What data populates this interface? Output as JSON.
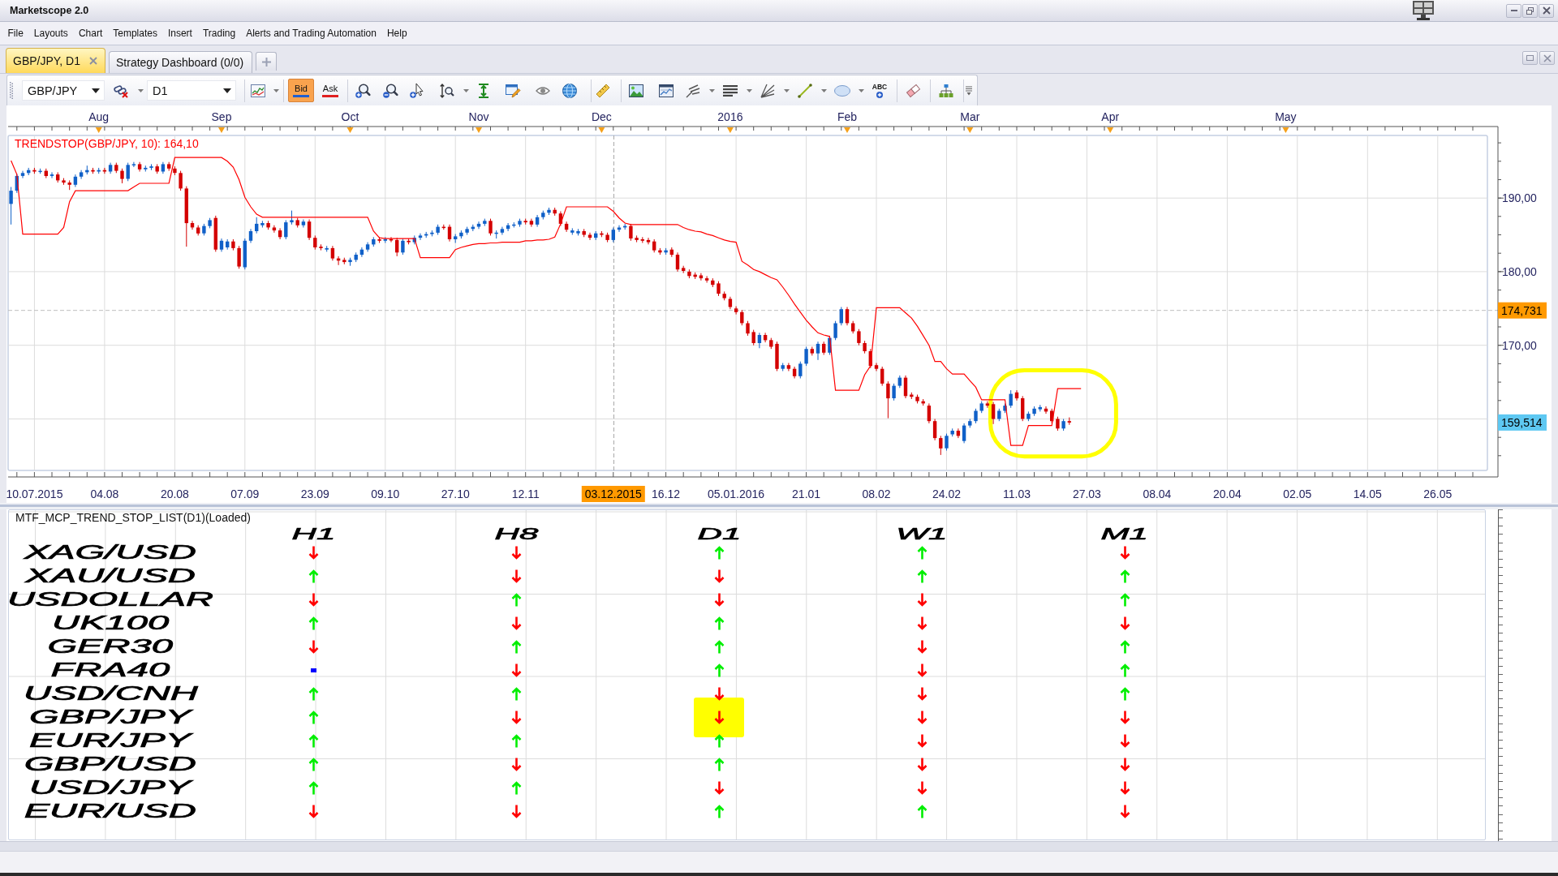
{
  "window": {
    "title": "Marketscope 2.0"
  },
  "menu": [
    "File",
    "Layouts",
    "Chart",
    "Templates",
    "Insert",
    "Trading",
    "Alerts and Trading Automation",
    "Help"
  ],
  "tabs": [
    {
      "label": "GBP/JPY, D1",
      "selected": true,
      "closable": true
    },
    {
      "label": "Strategy Dashboard (0/0)",
      "selected": false,
      "closable": false
    }
  ],
  "toolbar": {
    "symbol": "GBP/JPY",
    "timeframe": "D1",
    "price_modes": [
      {
        "label": "Bid",
        "selected": true,
        "color": "#2060d0"
      },
      {
        "label": "Ask",
        "selected": false,
        "color": "#e02020"
      }
    ],
    "text_tool": "ABC"
  },
  "chart": {
    "month_axis": [
      "Aug",
      "Sep",
      "Oct",
      "Nov",
      "Dec",
      "2016",
      "Feb",
      "Mar",
      "Apr",
      "May"
    ],
    "highlight_ring": true,
    "chart_data": [
      {
        "type": "candlestick",
        "grid": true,
        "ylim": [
          153.0,
          198.5
        ],
        "categories": [
          null,
          null,
          null,
          null,
          "10.07.2015",
          null,
          null,
          null,
          null,
          null,
          null,
          null,
          null,
          null,
          null,
          null,
          "04.08",
          null,
          null,
          null,
          null,
          null,
          null,
          null,
          null,
          null,
          null,
          null,
          "20.08",
          null,
          null,
          null,
          null,
          null,
          null,
          null,
          null,
          null,
          null,
          null,
          "07.09",
          null,
          null,
          null,
          null,
          null,
          null,
          null,
          null,
          null,
          null,
          null,
          "23.09",
          null,
          null,
          null,
          null,
          null,
          null,
          null,
          null,
          null,
          null,
          null,
          "09.10",
          null,
          null,
          null,
          null,
          null,
          null,
          null,
          null,
          null,
          null,
          null,
          "27.10",
          null,
          null,
          null,
          null,
          null,
          null,
          null,
          null,
          null,
          null,
          null,
          "12.11",
          null,
          null,
          null,
          null,
          null,
          null,
          null,
          null,
          null,
          null,
          null,
          null,
          null,
          null,
          "03.12.2015",
          null,
          null,
          null,
          null,
          null,
          null,
          null,
          null,
          "16.12",
          null,
          null,
          null,
          null,
          null,
          null,
          null,
          null,
          null,
          null,
          null,
          "05.01.2016",
          null,
          null,
          null,
          null,
          null,
          null,
          null,
          null,
          null,
          null,
          null,
          "21.01",
          null,
          null,
          null,
          null,
          null,
          null,
          null,
          null,
          null,
          null,
          null,
          "08.02",
          null,
          null,
          null,
          null,
          null,
          null,
          null,
          null,
          null,
          null,
          null,
          "24.02",
          null,
          null,
          null,
          null,
          null,
          null,
          null,
          null,
          null,
          null,
          null,
          "11.03",
          null,
          null,
          null,
          null,
          null,
          null,
          null,
          null,
          null,
          null,
          null,
          "27.03",
          null,
          null,
          null,
          null,
          null,
          null,
          null,
          null,
          null,
          null,
          null,
          "08.04",
          null,
          null,
          null,
          null,
          null,
          null,
          null,
          null,
          null,
          null,
          null,
          "20.04",
          null,
          null,
          null,
          null,
          null,
          null,
          null,
          null,
          null,
          null,
          null,
          "02.05",
          null,
          null,
          null,
          null,
          null,
          null,
          null,
          null,
          null,
          null,
          null,
          "14.05",
          null,
          null,
          null,
          null,
          null,
          null,
          null,
          null,
          null,
          null,
          null,
          "26.05",
          null,
          null,
          null,
          null,
          null,
          null,
          null,
          null
        ],
        "yticks": [
          {
            "value": 170,
            "label": "170,00"
          },
          {
            "value": 180,
            "label": "180,00"
          },
          {
            "value": 190,
            "label": "190,00"
          }
        ],
        "ohlc": [
          [
            189.2,
            191.5,
            186.4,
            191.0
          ],
          [
            191.0,
            193.3,
            190.7,
            193.0
          ],
          [
            193.0,
            193.7,
            192.7,
            193.4
          ],
          [
            193.4,
            194.1,
            193.1,
            193.8
          ],
          [
            193.8,
            194.1,
            193.3,
            193.6
          ],
          [
            193.6,
            194.0,
            193.3,
            193.7
          ],
          [
            193.7,
            194.0,
            192.7,
            193.0
          ],
          [
            193.0,
            193.5,
            192.7,
            193.2
          ],
          [
            193.2,
            193.5,
            192.1,
            192.4
          ],
          [
            192.4,
            192.7,
            191.8,
            192.1
          ],
          [
            192.1,
            192.4,
            191.1,
            191.8
          ],
          [
            191.8,
            193.2,
            191.5,
            192.9
          ],
          [
            192.9,
            193.8,
            192.6,
            193.5
          ],
          [
            193.5,
            194.4,
            193.2,
            193.8
          ],
          [
            193.8,
            194.1,
            193.3,
            193.6
          ],
          [
            193.6,
            194.1,
            193.3,
            193.8
          ],
          [
            193.8,
            194.1,
            193.3,
            193.6
          ],
          [
            193.6,
            194.8,
            193.3,
            194.5
          ],
          [
            194.5,
            194.8,
            193.4,
            193.7
          ],
          [
            193.7,
            194.0,
            192.0,
            192.6
          ],
          [
            192.6,
            194.8,
            192.3,
            194.5
          ],
          [
            194.5,
            194.9,
            194.2,
            194.6
          ],
          [
            194.6,
            194.9,
            193.6,
            193.9
          ],
          [
            193.9,
            194.4,
            193.6,
            194.1
          ],
          [
            194.1,
            194.6,
            193.8,
            194.3
          ],
          [
            194.3,
            194.6,
            193.3,
            193.6
          ],
          [
            193.6,
            194.9,
            193.3,
            194.6
          ],
          [
            194.6,
            194.9,
            193.7,
            194.0
          ],
          [
            194.0,
            194.3,
            193.1,
            193.4
          ],
          [
            193.4,
            193.7,
            191.0,
            191.3
          ],
          [
            191.3,
            191.6,
            183.4,
            186.6
          ],
          [
            186.6,
            186.9,
            185.7,
            186.0
          ],
          [
            186.0,
            186.3,
            184.9,
            185.2
          ],
          [
            185.2,
            186.5,
            184.9,
            186.2
          ],
          [
            186.2,
            187.3,
            185.9,
            187.0
          ],
          [
            187.3,
            187.6,
            182.7,
            183.0
          ],
          [
            183.0,
            184.5,
            182.7,
            184.2
          ],
          [
            183.3,
            184.4,
            183.0,
            184.1
          ],
          [
            184.1,
            184.4,
            182.9,
            183.2
          ],
          [
            183.2,
            183.5,
            180.4,
            180.7
          ],
          [
            180.6,
            184.5,
            180.3,
            184.2
          ],
          [
            184.2,
            185.8,
            183.9,
            185.5
          ],
          [
            185.5,
            187.4,
            185.2,
            186.5
          ],
          [
            186.3,
            186.9,
            186.0,
            186.6
          ],
          [
            186.6,
            186.9,
            185.7,
            186.0
          ],
          [
            186.0,
            186.3,
            185.3,
            185.6
          ],
          [
            185.6,
            185.9,
            184.4,
            184.7
          ],
          [
            184.7,
            187.0,
            184.4,
            186.7
          ],
          [
            186.7,
            188.3,
            186.4,
            187.0
          ],
          [
            187.0,
            187.3,
            186.0,
            186.3
          ],
          [
            186.3,
            187.1,
            186.0,
            186.8
          ],
          [
            186.8,
            187.1,
            184.3,
            184.6
          ],
          [
            184.6,
            184.9,
            183.0,
            183.3
          ],
          [
            183.4,
            183.7,
            182.9,
            183.2
          ],
          [
            183.0,
            183.5,
            182.7,
            183.2
          ],
          [
            183.2,
            183.5,
            181.5,
            181.8
          ],
          [
            181.8,
            182.1,
            180.9,
            181.5
          ],
          [
            181.6,
            181.9,
            181.0,
            181.3
          ],
          [
            181.3,
            181.9,
            180.8,
            181.6
          ],
          [
            181.6,
            182.6,
            181.3,
            182.3
          ],
          [
            182.3,
            183.3,
            182.0,
            183.0
          ],
          [
            183.0,
            184.0,
            182.7,
            183.7
          ],
          [
            183.7,
            184.7,
            183.4,
            184.4
          ],
          [
            184.4,
            184.7,
            183.9,
            184.2
          ],
          [
            184.2,
            184.7,
            183.9,
            184.4
          ],
          [
            184.4,
            184.7,
            184.0,
            184.3
          ],
          [
            184.3,
            184.6,
            182.1,
            182.6
          ],
          [
            182.6,
            184.5,
            182.3,
            184.2
          ],
          [
            184.2,
            184.5,
            183.7,
            184.0
          ],
          [
            184.0,
            184.9,
            183.7,
            184.6
          ],
          [
            184.6,
            185.2,
            184.3,
            184.9
          ],
          [
            184.9,
            185.4,
            184.6,
            185.1
          ],
          [
            185.1,
            185.6,
            184.8,
            185.3
          ],
          [
            185.3,
            186.4,
            185.0,
            186.1
          ],
          [
            186.1,
            186.4,
            185.7,
            186.0
          ],
          [
            186.1,
            186.4,
            184.1,
            184.4
          ],
          [
            184.4,
            185.1,
            183.9,
            184.8
          ],
          [
            184.8,
            185.6,
            184.5,
            185.3
          ],
          [
            185.3,
            186.1,
            185.0,
            185.8
          ],
          [
            185.8,
            186.4,
            185.5,
            186.1
          ],
          [
            186.1,
            186.8,
            185.8,
            186.5
          ],
          [
            186.5,
            187.2,
            186.2,
            186.9
          ],
          [
            186.9,
            187.2,
            184.9,
            185.2
          ],
          [
            185.2,
            185.6,
            184.5,
            185.3
          ],
          [
            185.3,
            186.1,
            185.0,
            185.8
          ],
          [
            185.8,
            186.6,
            185.5,
            186.3
          ],
          [
            186.3,
            186.7,
            186.0,
            186.4
          ],
          [
            186.4,
            187.2,
            186.1,
            186.9
          ],
          [
            186.9,
            187.2,
            186.4,
            186.7
          ],
          [
            186.9,
            187.2,
            186.1,
            186.4
          ],
          [
            186.4,
            187.7,
            186.1,
            187.4
          ],
          [
            187.4,
            188.3,
            187.1,
            188.0
          ],
          [
            188.0,
            188.7,
            187.7,
            188.4
          ],
          [
            188.4,
            188.7,
            187.6,
            187.9
          ],
          [
            187.9,
            188.2,
            186.2,
            186.5
          ],
          [
            186.5,
            186.8,
            185.4,
            185.7
          ],
          [
            185.3,
            185.9,
            185.0,
            185.6
          ],
          [
            185.2,
            185.8,
            184.9,
            185.5
          ],
          [
            185.5,
            185.8,
            184.7,
            185.0
          ],
          [
            185.0,
            185.3,
            184.3,
            184.6
          ],
          [
            184.6,
            185.5,
            184.3,
            185.2
          ],
          [
            185.2,
            185.5,
            184.7,
            185.0
          ],
          [
            185.0,
            185.3,
            184.0,
            184.3
          ],
          [
            184.3,
            186.0,
            184.0,
            185.7
          ],
          [
            185.7,
            186.3,
            185.4,
            186.0
          ],
          [
            186.0,
            186.5,
            185.7,
            186.2
          ],
          [
            186.2,
            186.5,
            184.2,
            184.5
          ],
          [
            184.6,
            184.9,
            184.0,
            184.3
          ],
          [
            184.4,
            184.7,
            183.9,
            184.2
          ],
          [
            184.3,
            184.6,
            183.7,
            184.0
          ],
          [
            184.1,
            184.4,
            182.6,
            182.9
          ],
          [
            182.9,
            183.2,
            182.3,
            182.6
          ],
          [
            182.6,
            183.2,
            182.3,
            182.9
          ],
          [
            183.0,
            183.3,
            182.0,
            182.3
          ],
          [
            182.3,
            182.6,
            180.0,
            180.3
          ],
          [
            180.5,
            180.8,
            179.8,
            180.1
          ],
          [
            180.0,
            180.3,
            179.1,
            179.4
          ],
          [
            179.6,
            179.9,
            179.0,
            179.3
          ],
          [
            179.5,
            179.8,
            178.8,
            179.1
          ],
          [
            179.1,
            179.4,
            178.5,
            178.8
          ],
          [
            178.8,
            179.1,
            177.9,
            178.2
          ],
          [
            178.4,
            178.7,
            176.7,
            177.0
          ],
          [
            177.0,
            177.3,
            176.1,
            176.4
          ],
          [
            176.3,
            176.6,
            174.9,
            175.2
          ],
          [
            175.0,
            175.3,
            174.2,
            174.5
          ],
          [
            174.5,
            174.8,
            172.7,
            173.0
          ],
          [
            173.0,
            173.3,
            171.3,
            171.6
          ],
          [
            171.8,
            172.1,
            170.0,
            170.3
          ],
          [
            170.3,
            171.7,
            169.6,
            171.4
          ],
          [
            171.4,
            171.7,
            170.4,
            170.7
          ],
          [
            170.7,
            171.0,
            169.5,
            169.8
          ],
          [
            170.2,
            170.5,
            166.5,
            166.8
          ],
          [
            166.8,
            167.6,
            166.5,
            167.3
          ],
          [
            167.3,
            167.6,
            166.5,
            166.8
          ],
          [
            166.8,
            167.1,
            165.5,
            165.8
          ],
          [
            165.8,
            167.8,
            165.5,
            167.5
          ],
          [
            167.5,
            169.8,
            167.2,
            169.5
          ],
          [
            169.5,
            169.8,
            168.6,
            168.9
          ],
          [
            168.9,
            170.5,
            168.0,
            170.2
          ],
          [
            170.2,
            170.5,
            168.7,
            169.0
          ],
          [
            169.0,
            171.3,
            168.7,
            171.0
          ],
          [
            171.0,
            173.3,
            170.7,
            173.0
          ],
          [
            173.0,
            175.2,
            172.7,
            174.9
          ],
          [
            174.9,
            175.2,
            172.7,
            173.0
          ],
          [
            173.0,
            173.3,
            171.6,
            171.9
          ],
          [
            171.9,
            172.2,
            170.0,
            170.3
          ],
          [
            170.3,
            170.6,
            168.9,
            169.2
          ],
          [
            169.2,
            169.5,
            166.9,
            167.2
          ],
          [
            167.3,
            167.6,
            166.5,
            166.8
          ],
          [
            166.8,
            167.1,
            164.5,
            164.8
          ],
          [
            164.8,
            165.1,
            160.1,
            162.8
          ],
          [
            162.8,
            164.8,
            162.5,
            164.5
          ],
          [
            164.5,
            165.9,
            164.2,
            165.6
          ],
          [
            165.6,
            165.9,
            162.8,
            163.1
          ],
          [
            163.3,
            163.6,
            162.7,
            163.0
          ],
          [
            163.0,
            163.3,
            162.1,
            162.4
          ],
          [
            162.4,
            162.7,
            161.8,
            162.1
          ],
          [
            161.8,
            162.1,
            159.4,
            159.7
          ],
          [
            159.7,
            160.0,
            157.1,
            157.4
          ],
          [
            157.4,
            157.7,
            155.1,
            156.0
          ],
          [
            156.0,
            158.0,
            155.7,
            157.7
          ],
          [
            157.9,
            158.7,
            157.6,
            158.4
          ],
          [
            158.4,
            158.7,
            157.4,
            157.7
          ],
          [
            157.0,
            159.4,
            156.7,
            159.1
          ],
          [
            159.1,
            160.0,
            158.8,
            159.7
          ],
          [
            159.7,
            161.4,
            159.4,
            161.1
          ],
          [
            161.1,
            162.4,
            160.8,
            162.1
          ],
          [
            162.1,
            162.4,
            161.5,
            161.8
          ],
          [
            162.0,
            162.3,
            159.3,
            160.0
          ],
          [
            160.0,
            161.4,
            159.7,
            161.1
          ],
          [
            161.1,
            162.1,
            160.8,
            161.8
          ],
          [
            161.8,
            163.9,
            161.5,
            163.4
          ],
          [
            163.6,
            163.9,
            162.5,
            162.8
          ],
          [
            162.8,
            163.1,
            159.7,
            160.0
          ],
          [
            160.0,
            161.0,
            159.7,
            160.7
          ],
          [
            160.7,
            161.7,
            160.4,
            161.4
          ],
          [
            161.3,
            161.9,
            161.0,
            161.6
          ],
          [
            161.4,
            161.7,
            160.7,
            161.0
          ],
          [
            161.1,
            161.4,
            159.4,
            159.7
          ],
          [
            160.0,
            160.3,
            158.4,
            158.7
          ],
          [
            158.7,
            160.0,
            158.4,
            159.7
          ],
          [
            159.7,
            160.2,
            159.2,
            159.51
          ],
          null,
          null,
          null,
          null,
          null,
          null,
          null,
          null,
          null,
          null,
          null,
          null,
          null,
          null,
          null,
          null,
          null,
          null,
          null,
          null,
          null,
          null,
          null,
          null,
          null,
          null,
          null,
          null,
          null,
          null,
          null,
          null,
          null,
          null,
          null,
          null,
          null,
          null,
          null,
          null,
          null,
          null,
          null,
          null,
          null,
          null,
          null,
          null,
          null,
          null,
          null,
          null,
          null,
          null,
          null,
          null,
          null,
          null,
          null,
          null,
          null,
          null,
          null,
          null,
          null,
          null,
          null,
          null,
          null,
          null,
          null
        ],
        "series": [
          {
            "name": "TRENDSTOP(GBP/JPY, 10): 164,10",
            "type": "line",
            "color": "#ff0000",
            "values": [
              195.1,
              193.2,
              185.1,
              185.1,
              185.1,
              185.1,
              185.1,
              185.1,
              185.1,
              186.0,
              189.5,
              191.0,
              191.0,
              191.0,
              191.0,
              191.0,
              191.0,
              191.0,
              191.0,
              191.0,
              191.0,
              191.5,
              192.0,
              192.0,
              192.0,
              192.0,
              192.0,
              192.0,
              195.5,
              195.5,
              195.5,
              195.5,
              195.5,
              195.5,
              195.5,
              195.5,
              195.5,
              195.0,
              194.2,
              192.5,
              190.1,
              188.8,
              187.8,
              187.4,
              187.4,
              187.4,
              187.4,
              187.4,
              187.4,
              187.4,
              187.4,
              187.4,
              187.4,
              187.4,
              187.4,
              187.4,
              187.4,
              187.4,
              187.4,
              187.4,
              187.4,
              187.4,
              185.5,
              184.6,
              184.5,
              184.5,
              184.5,
              184.5,
              184.5,
              184.5,
              181.9,
              181.9,
              181.9,
              181.9,
              181.9,
              181.9,
              183.0,
              183.3,
              183.5,
              183.7,
              183.8,
              183.8,
              183.9,
              183.9,
              184.0,
              184.0,
              184.0,
              184.0,
              184.2,
              184.2,
              184.3,
              184.3,
              184.4,
              184.7,
              186.5,
              188.8,
              188.8,
              188.8,
              188.8,
              188.8,
              188.8,
              188.8,
              188.8,
              188.2,
              187.3,
              186.6,
              186.4,
              186.4,
              186.4,
              186.4,
              186.4,
              186.4,
              186.4,
              186.4,
              186.4,
              186.0,
              185.7,
              185.5,
              185.4,
              185.1,
              184.9,
              184.6,
              184.3,
              184.1,
              184.0,
              181.4,
              180.9,
              180.3,
              180.0,
              179.6,
              179.2,
              178.9,
              177.9,
              176.8,
              175.6,
              174.5,
              173.4,
              172.5,
              171.7,
              171.4,
              171.2,
              163.9,
              163.9,
              163.9,
              163.9,
              163.9,
              166.0,
              167.2,
              175.1,
              175.1,
              175.1,
              175.1,
              175.1,
              174.4,
              173.7,
              172.6,
              171.3,
              170.0,
              167.8,
              167.8,
              166.8,
              166.1,
              166.1,
              166.1,
              165.2,
              164.3,
              162.6,
              162.6,
              162.6,
              162.6,
              162.6,
              156.4,
              156.4,
              156.4,
              159.1,
              159.1,
              159.1,
              159.1,
              159.1,
              164.1,
              164.1,
              164.1,
              164.1,
              164.1,
              null,
              null,
              null,
              null,
              null,
              null,
              null,
              null,
              null,
              null,
              null,
              null,
              null,
              null,
              null,
              null,
              null,
              null,
              null,
              null,
              null,
              null,
              null,
              null,
              null,
              null,
              null,
              null,
              null,
              null,
              null,
              null,
              null,
              null,
              null,
              null,
              null,
              null,
              null,
              null,
              null,
              null,
              null,
              null,
              null,
              null,
              null,
              null,
              null,
              null,
              null,
              null,
              null,
              null,
              null,
              null,
              null,
              null,
              null,
              null,
              null,
              null,
              null,
              null,
              null,
              null,
              null,
              null,
              null
            ]
          }
        ],
        "ref_lines": [
          {
            "axis": "y",
            "value": 174.731,
            "label": "174,731",
            "color": "#bdbdbd",
            "line_style": "dashed"
          },
          {
            "axis": "x",
            "value": "03.12.2015",
            "color": "#a8a8a8",
            "line_style": "dashed"
          }
        ],
        "annotations": [
          "159,514"
        ]
      }
    ]
  },
  "indicator_list": {
    "title": "MTF_MCP_TREND_STOP_LIST(D1)(Loaded)",
    "columns": [
      "H1",
      "H8",
      "D1",
      "W1",
      "M1"
    ],
    "rows": [
      {
        "instrument": "XAG/USD",
        "signals": [
          {
            "kind": "down",
            "marked": false
          },
          {
            "kind": "down",
            "marked": false
          },
          {
            "kind": "up",
            "marked": false
          },
          {
            "kind": "up",
            "marked": false
          },
          {
            "kind": "down",
            "marked": false
          }
        ]
      },
      {
        "instrument": "XAU/USD",
        "signals": [
          {
            "kind": "up",
            "marked": false
          },
          {
            "kind": "down",
            "marked": false
          },
          {
            "kind": "down",
            "marked": false
          },
          {
            "kind": "up",
            "marked": false
          },
          {
            "kind": "up",
            "marked": false
          }
        ]
      },
      {
        "instrument": "USDOLLAR",
        "signals": [
          {
            "kind": "down",
            "marked": false
          },
          {
            "kind": "up",
            "marked": false
          },
          {
            "kind": "down",
            "marked": false
          },
          {
            "kind": "down",
            "marked": false
          },
          {
            "kind": "up",
            "marked": false
          }
        ]
      },
      {
        "instrument": "UK100",
        "signals": [
          {
            "kind": "up",
            "marked": false
          },
          {
            "kind": "down",
            "marked": false
          },
          {
            "kind": "up",
            "marked": false
          },
          {
            "kind": "down",
            "marked": false
          },
          {
            "kind": "down",
            "marked": false
          }
        ]
      },
      {
        "instrument": "GER30",
        "signals": [
          {
            "kind": "down",
            "marked": false
          },
          {
            "kind": "up",
            "marked": false
          },
          {
            "kind": "up",
            "marked": false
          },
          {
            "kind": "down",
            "marked": false
          },
          {
            "kind": "up",
            "marked": false
          }
        ]
      },
      {
        "instrument": "FRA40",
        "signals": [
          {
            "kind": "flat",
            "marked": false
          },
          {
            "kind": "down",
            "marked": false
          },
          {
            "kind": "up",
            "marked": false
          },
          {
            "kind": "down",
            "marked": false
          },
          {
            "kind": "up",
            "marked": false
          }
        ]
      },
      {
        "instrument": "USD/CNH",
        "signals": [
          {
            "kind": "up",
            "marked": false
          },
          {
            "kind": "up",
            "marked": false
          },
          {
            "kind": "down",
            "marked": false
          },
          {
            "kind": "down",
            "marked": false
          },
          {
            "kind": "up",
            "marked": false
          }
        ]
      },
      {
        "instrument": "GBP/JPY",
        "signals": [
          {
            "kind": "up",
            "marked": false
          },
          {
            "kind": "down",
            "marked": false
          },
          {
            "kind": "down",
            "marked": true
          },
          {
            "kind": "down",
            "marked": false
          },
          {
            "kind": "down",
            "marked": false
          }
        ]
      },
      {
        "instrument": "EUR/JPY",
        "signals": [
          {
            "kind": "up",
            "marked": false
          },
          {
            "kind": "up",
            "marked": false
          },
          {
            "kind": "up",
            "marked": false
          },
          {
            "kind": "down",
            "marked": false
          },
          {
            "kind": "down",
            "marked": false
          }
        ]
      },
      {
        "instrument": "GBP/USD",
        "signals": [
          {
            "kind": "up",
            "marked": false
          },
          {
            "kind": "down",
            "marked": false
          },
          {
            "kind": "up",
            "marked": false
          },
          {
            "kind": "down",
            "marked": false
          },
          {
            "kind": "down",
            "marked": false
          }
        ]
      },
      {
        "instrument": "USD/JPY",
        "signals": [
          {
            "kind": "up",
            "marked": false
          },
          {
            "kind": "up",
            "marked": false
          },
          {
            "kind": "down",
            "marked": false
          },
          {
            "kind": "down",
            "marked": false
          },
          {
            "kind": "down",
            "marked": false
          }
        ]
      },
      {
        "instrument": "EUR/USD",
        "signals": [
          {
            "kind": "down",
            "marked": false
          },
          {
            "kind": "down",
            "marked": false
          },
          {
            "kind": "up",
            "marked": false
          },
          {
            "kind": "up",
            "marked": false
          },
          {
            "kind": "down",
            "marked": false
          }
        ]
      }
    ]
  }
}
